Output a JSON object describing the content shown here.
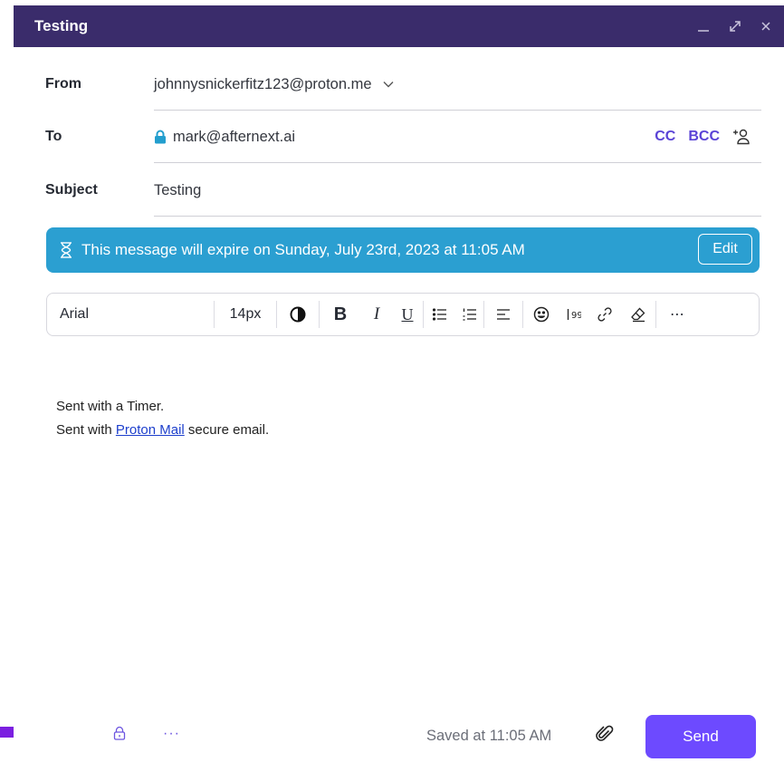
{
  "window": {
    "title": "Testing"
  },
  "from": {
    "label": "From",
    "value": "johnnysnickerfitz123@proton.me"
  },
  "to": {
    "label": "To",
    "value": "mark@afternext.ai",
    "cc_label": "CC",
    "bcc_label": "BCC"
  },
  "subject": {
    "label": "Subject",
    "value": "Testing"
  },
  "expiration": {
    "message": "This message will expire on Sunday, July 23rd, 2023 at 11:05 AM",
    "edit_label": "Edit"
  },
  "toolbar": {
    "font": "Arial",
    "size": "14px",
    "bold": "B",
    "italic": "I",
    "underline": "U",
    "more": "⋯"
  },
  "body": {
    "line1": "Sent with a Timer.",
    "line2_prefix": "Sent with ",
    "line2_link": "Proton Mail",
    "line2_suffix": " secure email."
  },
  "footer": {
    "saved_text": "Saved at 11:05 AM",
    "send_label": "Send",
    "more": "···"
  },
  "colors": {
    "titlebar": "#3a2c6b",
    "accent": "#6d4aff",
    "banner": "#2b9fd1",
    "annotation_arrow": "#7b1fe0"
  }
}
